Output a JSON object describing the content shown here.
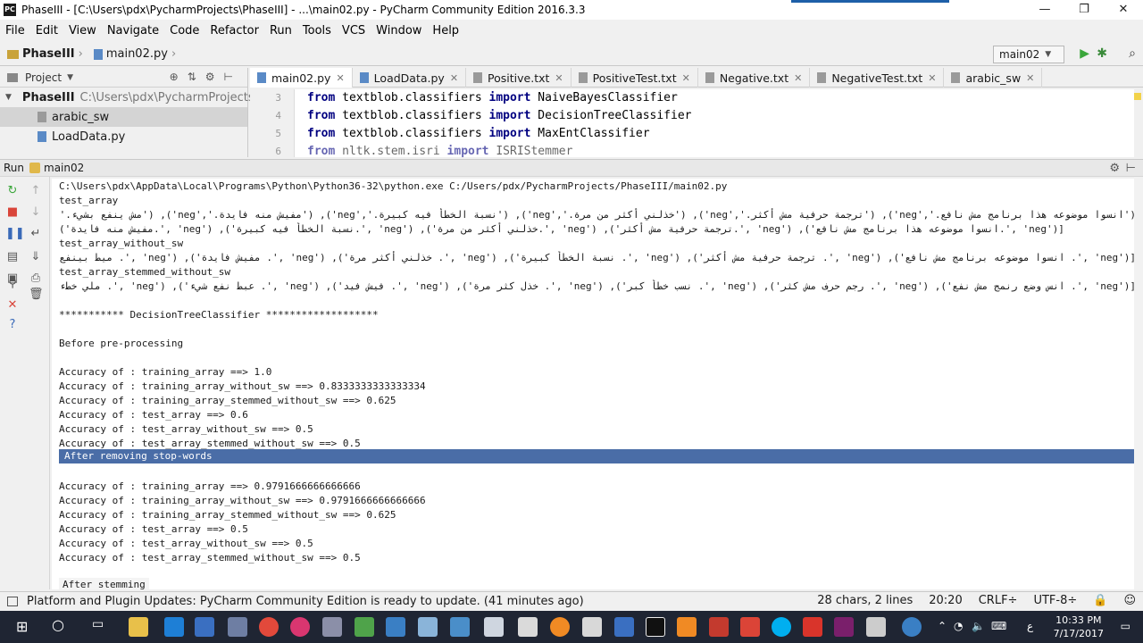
{
  "window": {
    "title": "PhaseIII - [C:\\Users\\pdx\\PycharmProjects\\PhaseIII] - ...\\main02.py - PyCharm Community Edition 2016.3.3",
    "minimize": "—",
    "maximize": "❐",
    "close": "✕"
  },
  "menu": [
    "File",
    "Edit",
    "View",
    "Navigate",
    "Code",
    "Refactor",
    "Run",
    "Tools",
    "VCS",
    "Window",
    "Help"
  ],
  "navbar": {
    "project": "PhaseIII",
    "file": "main02.py",
    "run_config": "main02"
  },
  "project_pane": {
    "header": "Project",
    "root_name": "PhaseIII",
    "root_path": "C:\\Users\\pdx\\PycharmProjects\\P",
    "items": [
      "arabic_sw",
      "LoadData.py"
    ]
  },
  "tabs": [
    {
      "label": "main02.py",
      "kind": "py"
    },
    {
      "label": "LoadData.py",
      "kind": "py"
    },
    {
      "label": "Positive.txt",
      "kind": "txt"
    },
    {
      "label": "PositiveTest.txt",
      "kind": "txt"
    },
    {
      "label": "Negative.txt",
      "kind": "txt"
    },
    {
      "label": "NegativeTest.txt",
      "kind": "txt"
    },
    {
      "label": "arabic_sw",
      "kind": "txt"
    }
  ],
  "editor": {
    "line_numbers": [
      "3",
      "4",
      "5",
      "6"
    ],
    "lines": [
      {
        "kw1": "from",
        "mod": " textblob.classifiers ",
        "kw2": "import",
        "name": " NaiveBayesClassifier"
      },
      {
        "kw1": "from",
        "mod": " textblob.classifiers ",
        "kw2": "import",
        "name": " DecisionTreeClassifier"
      },
      {
        "kw1": "from",
        "mod": " textblob.classifiers ",
        "kw2": "import",
        "name": " MaxEntClassifier"
      },
      {
        "kw1": "from",
        "mod": " nltk.stem.isri ",
        "kw2": "import",
        "name": " ISRIStemmer"
      }
    ]
  },
  "run_panel": {
    "label": "Run",
    "config": "main02"
  },
  "console": {
    "cmd": "C:\\Users\\pdx\\AppData\\Local\\Programs\\Python\\Python36-32\\python.exe C:/Users/pdx/PycharmProjects/PhaseIII/main02.py",
    "arabic_1": "('انسوا موضوعه هذا برنامج مش نافع.','neg'), ('ترجمة حرفية مش أكثر.','neg'), ('خذلني أكثر من مرة.','neg'), ('نسبة الخطأ فيه كبيرة.','neg'), ('مفيش منه فايدة.','neg'), ('مش ينفع بشيء.','neg')",
    "test_array": "test_array",
    "arabic_2": "[('neg' ,'.انسوا موضوعه هذا برنامج مش نافع'), ('neg' ,'.ترجمة حرفية مش أكثر'), ('neg' ,'.خذلني أكثر من مرة'), ('neg' ,'.نسبة الخطأ فيه كبيرة'), ('neg' ,'.مفيش منه فايدة')",
    "test_array_without_sw": "test_array_without_sw",
    "arabic_3": "[('neg' ,'. انسوا موضوعه برنامج مش نافع'), ('neg' ,'. ترجمة حرفية مش أكثر'), ('neg' ,'. نسبة الخطأ كبيرة'), ('neg' ,'. خذلني أكثر مرة'), ('neg' ,'. مفيش فايدة'), ('neg' ,'. ميط بينفع شيء')",
    "test_array_stemmed_without_sw": "test_array_stemmed_without_sw",
    "arabic_4": "[('neg' ,'. انس وضع رنمج مش نفع'), ('neg' ,'. رجم حرف مش كثر'), ('neg' ,'. نسب خطأ كبر'), ('neg' ,'. خذل كثر مرة'), ('neg' ,'. فيش فيد'), ('neg' ,'. عبط نفع شيء'), ('neg' ,'. ملي خطء رجم')",
    "dt_header": "*********** DecisionTreeClassifier *******************",
    "before_pre": "Before pre-processing",
    "before_results": [
      "Accuracy of :  training_array ==>  1.0",
      "Accuracy of :  training_array_without_sw ==>  0.8333333333333334",
      "Accuracy of :  training_array_stemmed_without_sw ==>  0.625",
      "Accuracy of :  test_array ==>  0.6",
      "Accuracy of :  test_array_without_sw ==>  0.5",
      "Accuracy of :  test_array_stemmed_without_sw ==>  0.5"
    ],
    "after_removing": "After removing stop-words",
    "after_results": [
      "Accuracy of :  training_array ==>  0.9791666666666666",
      "Accuracy of :  training_array_without_sw ==>  0.9791666666666666",
      "Accuracy of :  training_array_stemmed_without_sw ==>  0.625",
      "Accuracy of :  test_array ==>  0.5",
      "Accuracy of :  test_array_without_sw ==>  0.5",
      "Accuracy of :  test_array_stemmed_without_sw ==>  0.5"
    ],
    "after_stemming": "After stemming"
  },
  "status": {
    "message": "Platform and Plugin Updates: PyCharm Community Edition is ready to update. (41 minutes ago)",
    "selection": "28 chars, 2 lines",
    "position": "20:20",
    "line_sep": "CRLF÷",
    "encoding": "UTF-8÷"
  },
  "taskbar": {
    "time": "10:33 PM",
    "date": "7/17/2017",
    "lang": "ع"
  }
}
